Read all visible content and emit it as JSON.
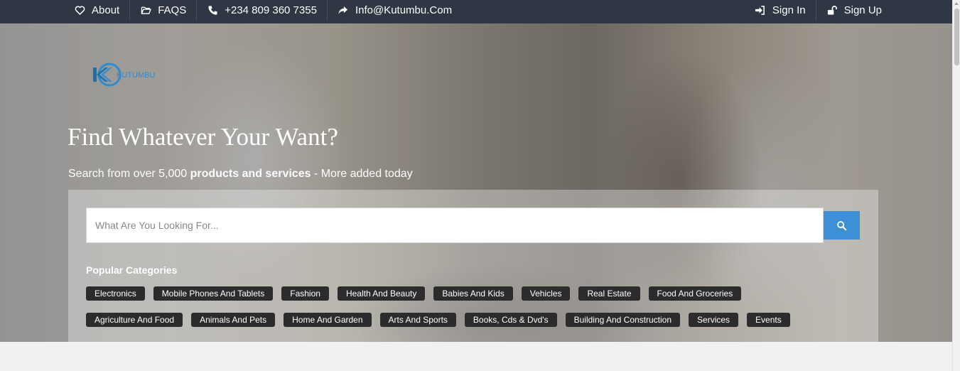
{
  "topbar": {
    "left": [
      {
        "label": "About",
        "icon": "heart-icon"
      },
      {
        "label": "FAQS",
        "icon": "folder-icon"
      },
      {
        "label": "+234 809 360 7355",
        "icon": "phone-icon"
      },
      {
        "label": "Info@Kutumbu.Com",
        "icon": "share-icon"
      }
    ],
    "right": [
      {
        "label": "Sign In",
        "icon": "sign-in-icon"
      },
      {
        "label": "Sign Up",
        "icon": "unlock-icon"
      }
    ]
  },
  "logo": {
    "text": "KUTUMBU"
  },
  "hero": {
    "title": "Find Whatever Your Want?",
    "subtitle_prefix": "Search from over 5,000 ",
    "subtitle_bold": "products and services",
    "subtitle_suffix": " - More added today"
  },
  "search": {
    "placeholder": "What Are You Looking For...",
    "value": ""
  },
  "popular": {
    "title": "Popular Categories",
    "row1": [
      "Electronics",
      "Mobile Phones And Tablets",
      "Fashion",
      "Health And Beauty",
      "Babies And Kids",
      "Vehicles",
      "Real Estate",
      "Food And Groceries"
    ],
    "row2": [
      "Agriculture And Food",
      "Animals And Pets",
      "Home And Garden",
      "Arts And Sports",
      "Books, Cds & Dvd's",
      "Building And Construction",
      "Services",
      "Events"
    ]
  },
  "colors": {
    "topbar_bg": "#2e3743",
    "search_button": "#3d8fd6",
    "tag_bg": "#2c2c2c"
  }
}
